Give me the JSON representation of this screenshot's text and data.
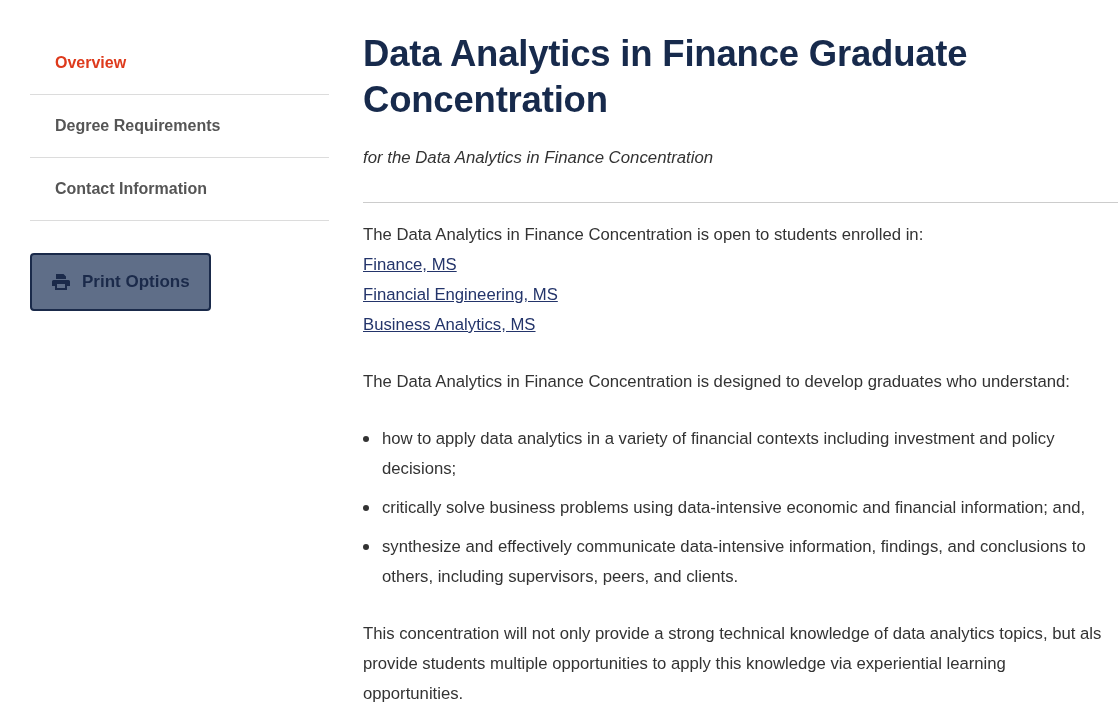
{
  "sidebar": {
    "nav_items": [
      {
        "label": "Overview",
        "selected": true
      },
      {
        "label": "Degree Requirements",
        "selected": false
      },
      {
        "label": "Contact Information",
        "selected": false
      }
    ],
    "print_button": {
      "label": "Print Options"
    }
  },
  "main": {
    "title": "Data Analytics in Finance Graduate Concentration",
    "subtitle": "for the Data Analytics in Finance Concentration",
    "intro": "The Data Analytics in Finance Concentration is open to students enrolled in:",
    "program_links": [
      "Finance, MS",
      "Financial Engineering, MS",
      "Business Analytics, MS"
    ],
    "outcomes_intro": "The Data Analytics in Finance Concentration is designed to develop graduates who understand:",
    "outcomes": [
      "how to apply data analytics in a variety of financial contexts including investment and policy decisions;",
      "critically solve business problems using data-intensive economic and financial information; and,",
      "synthesize and effectively communicate data-intensive information, findings, and conclusions to others, including supervisors, peers, and clients."
    ],
    "closing_paragraph": {
      "lines": [
        "This concentration will not only provide a strong technical knowledge of data analytics topics, but als",
        "provide students multiple opportunities to apply this knowledge via experiential learning",
        "opportunities."
      ]
    }
  }
}
